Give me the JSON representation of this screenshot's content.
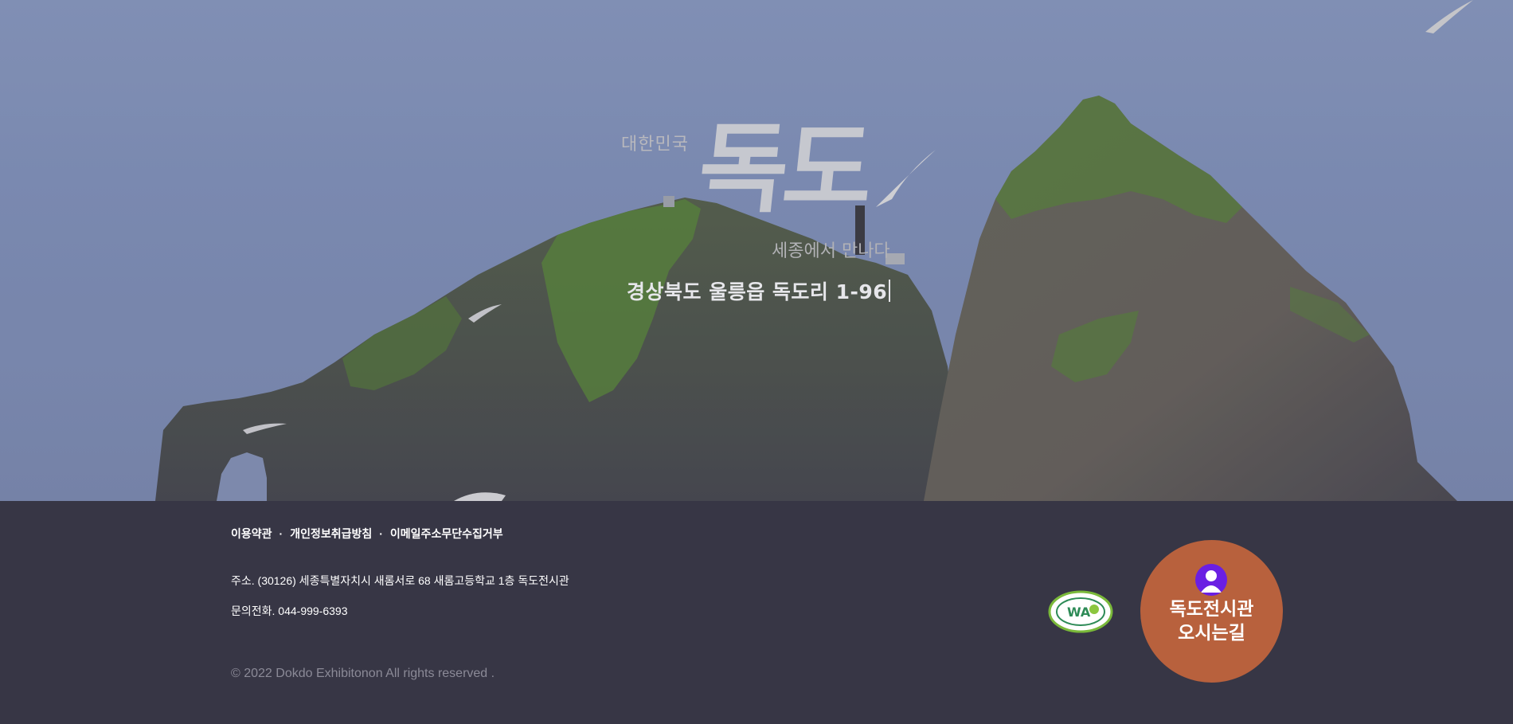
{
  "hero": {
    "tagline_top": "대한민국",
    "title": "독도",
    "tagline_bottom": "세종에서 만나다",
    "address": "경상북도 울릉읍 독도리 1-96"
  },
  "footer": {
    "links": [
      "이용약관",
      "개인정보취급방침",
      "이메일주소무단수집거부"
    ],
    "separator": "·",
    "address": "주소. (30126) 세종특별자치시 새롬서로 68 새롬고등학교 1층 독도전시관",
    "phone": "문의전화. 044-999-6393",
    "copyright": "© 2022 Dokdo Exhibitonon All rights reserved ."
  },
  "wa_mark": {
    "icon": "web-accessibility-certification-mark",
    "text": "WA"
  },
  "directions_button": {
    "line1": "독도전시관",
    "line2": "오시는길",
    "icon": "person-icon"
  },
  "colors": {
    "footer_bg": "#373645",
    "directions_bg": "#b8613d",
    "person_icon_bg": "#6a1fe3"
  }
}
